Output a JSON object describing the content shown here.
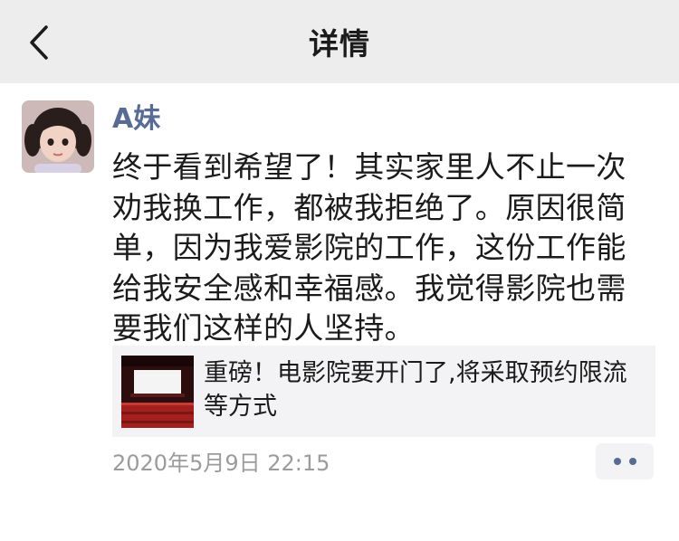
{
  "header": {
    "title": "详情",
    "back_icon": "chevron-left-icon"
  },
  "post": {
    "author": "A妹",
    "avatar_icon": "child-avatar",
    "text": "终于看到希望了！其实家里人不止一次\n劝我换工作，都被我拒绝了。原因很简\n单，因为我爱影院的工作，这份工作能\n给我安全感和幸福感。我觉得影院也需\n要我们这样的人坚持。",
    "link": {
      "title": "重磅！电影院要开门了,将采取预约限流等方式",
      "thumb_icon": "cinema-thumbnail"
    },
    "timestamp": "2020年5月9日  22:15",
    "more_icon": "more-dots-icon"
  },
  "colors": {
    "nav_bg": "#ededed",
    "name": "#576b95",
    "card_bg": "#f3f3f5",
    "muted": "#9b9b9b"
  }
}
